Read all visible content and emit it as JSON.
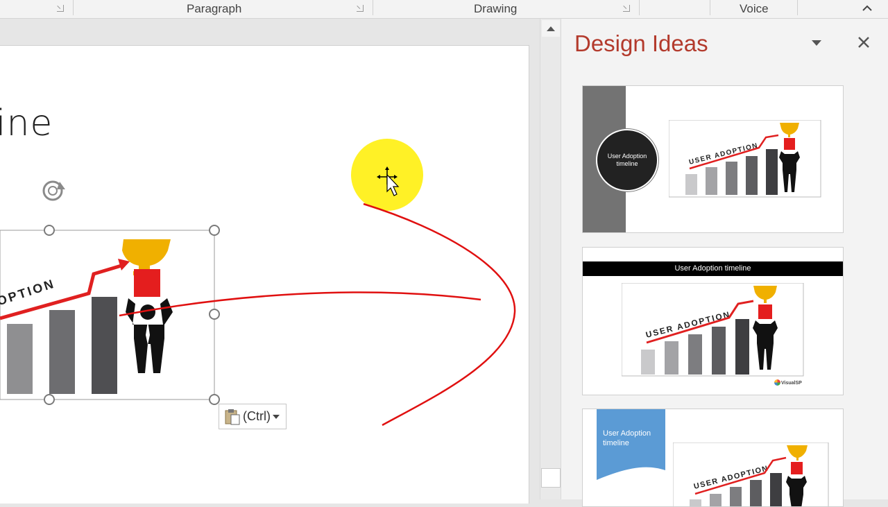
{
  "ribbon": {
    "groups": [
      "Paragraph",
      "Drawing",
      "Voice"
    ]
  },
  "slide": {
    "title_fragment": "ine",
    "picture_text": "OPTION"
  },
  "paste_options": {
    "label": "(Ctrl)"
  },
  "design_pane": {
    "title": "Design Ideas",
    "ideas": [
      {
        "title_text": "User Adoption timeline",
        "picture_text": "USER ADOPTION"
      },
      {
        "title_text": "User Adoption timeline",
        "picture_text": "USER ADOPTION",
        "logo_text": "VisualSP"
      },
      {
        "title_text": "User Adoption timeline",
        "picture_text": "USER ADOPTION"
      }
    ]
  },
  "colors": {
    "pane_title": "#b33a2c",
    "annotation_red": "#e01010",
    "cursor_highlight": "#ffee00",
    "idea_blue": "#5b9bd5"
  },
  "icons": {
    "collapse_ribbon": "chevron-up-icon",
    "pane_menu": "chevron-down-icon",
    "pane_close": "close-icon",
    "rotate_handle": "rotate-icon",
    "paste": "clipboard-icon",
    "cursor": "move-cursor-icon"
  }
}
